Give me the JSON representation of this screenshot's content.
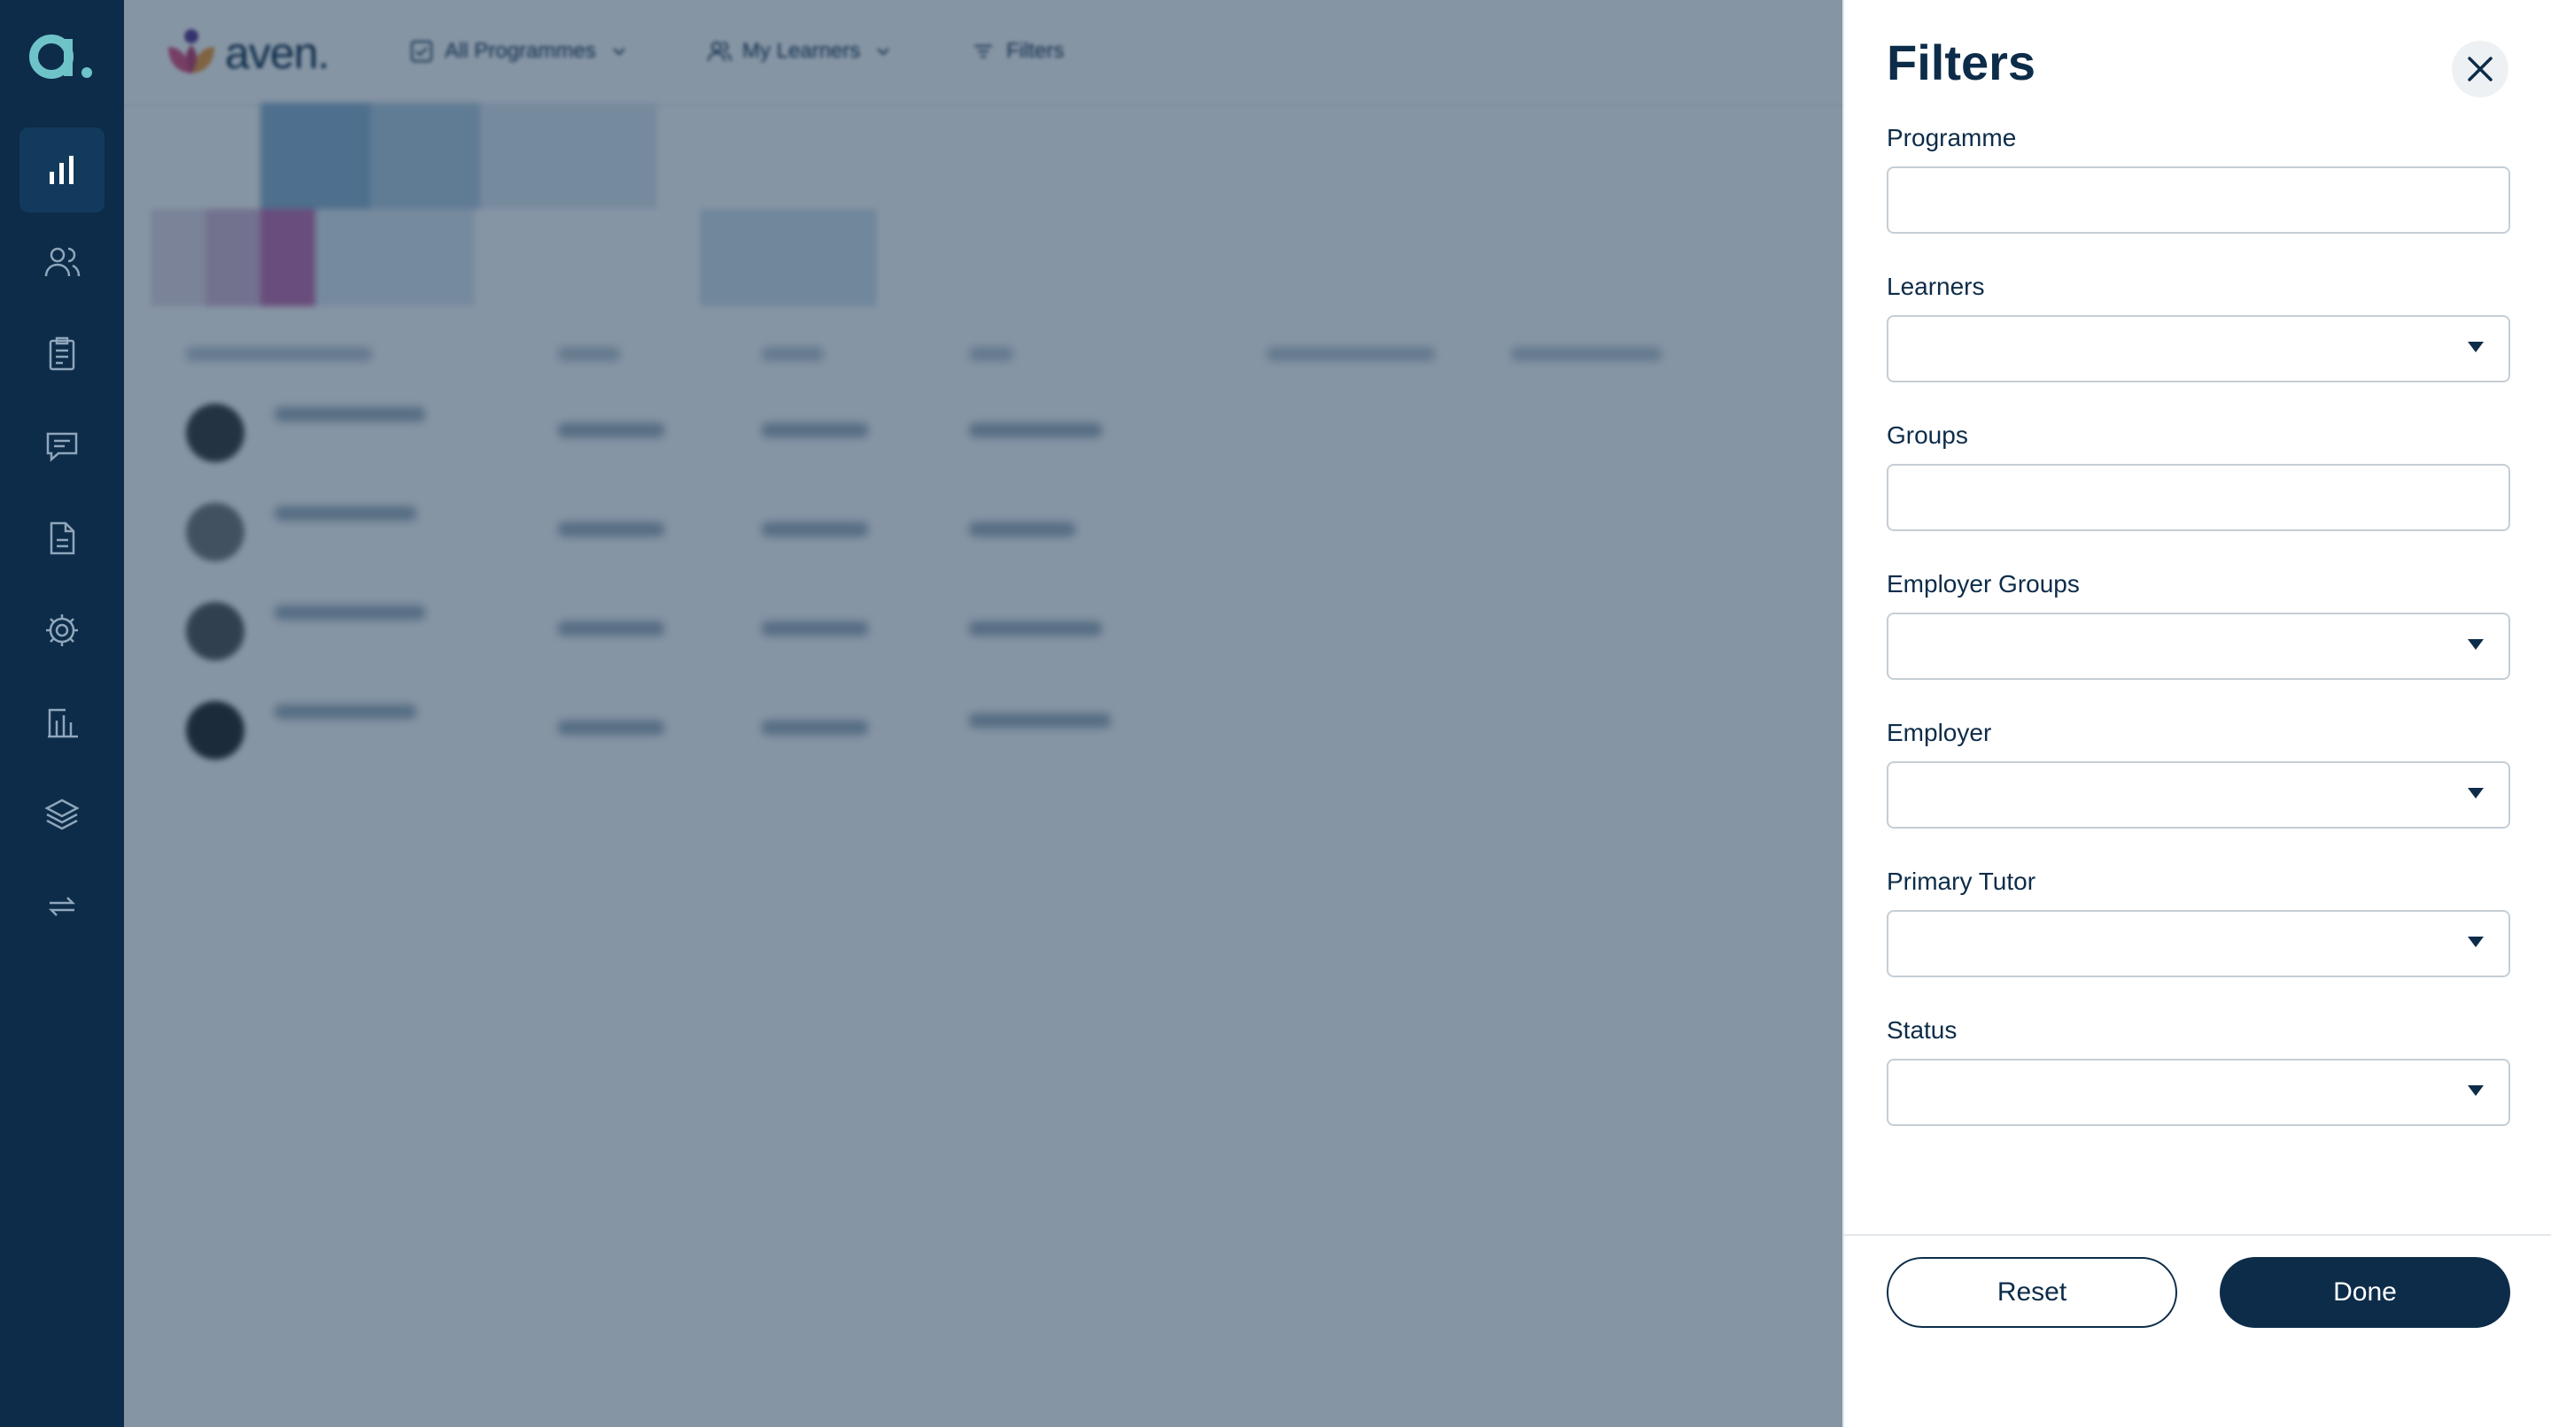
{
  "sidebar": {
    "logo_icon": "aven-a-logo",
    "items": [
      {
        "icon": "bar-chart-icon",
        "active": true
      },
      {
        "icon": "users-icon",
        "active": false
      },
      {
        "icon": "clipboard-icon",
        "active": false
      },
      {
        "icon": "chat-icon",
        "active": false
      },
      {
        "icon": "document-icon",
        "active": false
      },
      {
        "icon": "gear-icon",
        "active": false
      },
      {
        "icon": "report-icon",
        "active": false
      },
      {
        "icon": "layers-icon",
        "active": false
      },
      {
        "icon": "sync-icon",
        "active": false
      }
    ]
  },
  "header": {
    "brand": "aven.",
    "all_programmes": "All Programmes",
    "my_learners": "My Learners",
    "filters": "Filters"
  },
  "filters_panel": {
    "title": "Filters",
    "fields": [
      {
        "label": "Programme",
        "type": "text",
        "value": ""
      },
      {
        "label": "Learners",
        "type": "select",
        "value": ""
      },
      {
        "label": "Groups",
        "type": "text",
        "value": ""
      },
      {
        "label": "Employer Groups",
        "type": "select",
        "value": ""
      },
      {
        "label": "Employer",
        "type": "select",
        "value": ""
      },
      {
        "label": "Primary Tutor",
        "type": "select",
        "value": ""
      },
      {
        "label": "Status",
        "type": "select",
        "value": ""
      }
    ],
    "reset_label": "Reset",
    "done_label": "Done"
  },
  "colors": {
    "navy": "#0d2c49",
    "overlay": "#0d2c49"
  }
}
